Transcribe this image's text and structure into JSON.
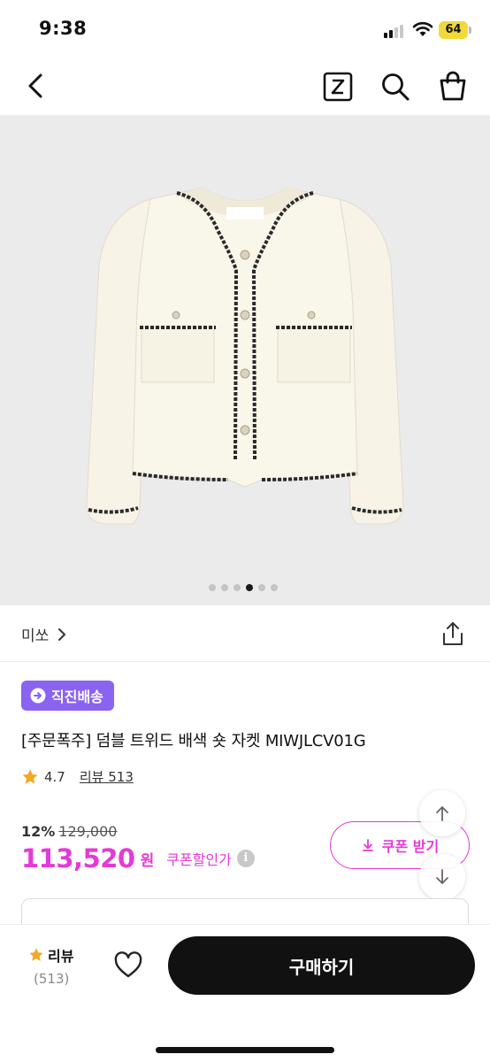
{
  "status_bar": {
    "time": "9:38",
    "battery": "64"
  },
  "nav": {
    "back_icon": "chevron-left-icon",
    "z_icon": "z-box-icon",
    "search_icon": "search-icon",
    "bag_icon": "shopping-bag-icon"
  },
  "gallery": {
    "total_images": 6,
    "active_index": 3,
    "image_subject": "cream tweed short jacket"
  },
  "brand": {
    "name": "미쏘"
  },
  "badge": {
    "label": "직진배송",
    "color": "#8a63f0"
  },
  "product": {
    "title": "[주문폭주] 덤블 트위드 배색 숏 자켓 MIWJLCV01G",
    "rating": "4.7",
    "review_label": "리뷰 513"
  },
  "price": {
    "discount_rate": "12%",
    "original_price": "129,000",
    "sale_price": "113,520",
    "currency": "원",
    "coupon_discount_label": "쿠폰할인가",
    "accent_color": "#e43ad7"
  },
  "coupon_button": {
    "label": "쿠폰 받기"
  },
  "bottom_bar": {
    "review_label": "리뷰",
    "review_count": "(513)",
    "buy_label": "구매하기"
  }
}
